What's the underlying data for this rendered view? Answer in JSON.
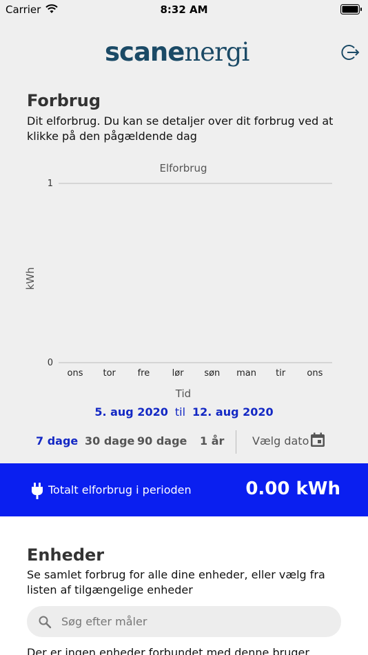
{
  "status": {
    "carrier": "Carrier",
    "time": "8:32 AM"
  },
  "header": {
    "logo_bold": "scan",
    "logo_e": "e",
    "logo_rest": "nergi"
  },
  "consumption": {
    "title": "Forbrug",
    "description": "Dit elforbrug. Du kan se detaljer over dit forbrug ved at klikke på den pågældende dag"
  },
  "chart_data": {
    "type": "bar",
    "title": "Elforbrug",
    "xlabel": "Tid",
    "ylabel": "kWh",
    "categories": [
      "ons",
      "tor",
      "fre",
      "lør",
      "søn",
      "man",
      "tir",
      "ons"
    ],
    "values": [
      0,
      0,
      0,
      0,
      0,
      0,
      0,
      0
    ],
    "ylim": [
      0,
      1
    ],
    "yticks": [
      "0",
      "1"
    ],
    "grid": true
  },
  "range": {
    "from": "5. aug 2020",
    "sep": "til",
    "to": "12. aug 2020"
  },
  "periods": {
    "p7": "7 dage",
    "p30": "30 dage",
    "p90": "90 dage",
    "p1y": "1 år",
    "choose": "Vælg dato"
  },
  "total": {
    "label": "Totalt elforbrug i perioden",
    "value": "0.00 kWh"
  },
  "devices": {
    "title": "Enheder",
    "description": "Se samlet forbrug for alle dine enheder, eller vælg fra listen af tilgængelige enheder",
    "search_placeholder": "Søg efter måler",
    "empty": "Der er ingen enheder forbundet med denne bruger"
  },
  "colors": {
    "accent": "#1328c4",
    "banner": "#0a1ff0",
    "brand": "#1b4a66"
  }
}
